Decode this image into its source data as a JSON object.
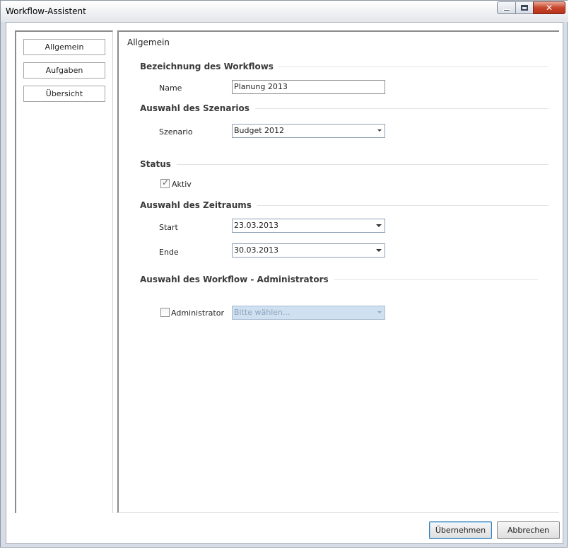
{
  "window": {
    "title": "Workflow-Assistent",
    "controls": {
      "minimize": "minimize-icon",
      "maximize": "maximize-icon",
      "close": "close-icon"
    }
  },
  "nav": {
    "items": [
      {
        "label": "Allgemein"
      },
      {
        "label": "Aufgaben"
      },
      {
        "label": "Übersicht"
      }
    ]
  },
  "content": {
    "title": "Allgemein",
    "sections": {
      "workflow_name": {
        "title": "Bezeichnung des Workflows",
        "name_label": "Name",
        "name_value": "Planung 2013"
      },
      "scenario": {
        "title": "Auswahl des Szenarios",
        "scenario_label": "Szenario",
        "scenario_value": "Budget 2012"
      },
      "status": {
        "title": "Status",
        "active_label": "Aktiv",
        "active_checked": true
      },
      "period": {
        "title": "Auswahl des Zeitraums",
        "start_label": "Start",
        "start_value": "23.03.2013",
        "end_label": "Ende",
        "end_value": "30.03.2013"
      },
      "administrator": {
        "title": "Auswahl des Workflow - Administrators",
        "admin_label": "Administrator",
        "admin_checked": false,
        "admin_placeholder": "Bitte wählen..."
      }
    }
  },
  "footer": {
    "apply_label": "Übernehmen",
    "cancel_label": "Abbrechen"
  },
  "colors": {
    "accent": "#3c7fb1",
    "disabled_combo": "#cfe0f1",
    "close_button": "#c7442c"
  }
}
